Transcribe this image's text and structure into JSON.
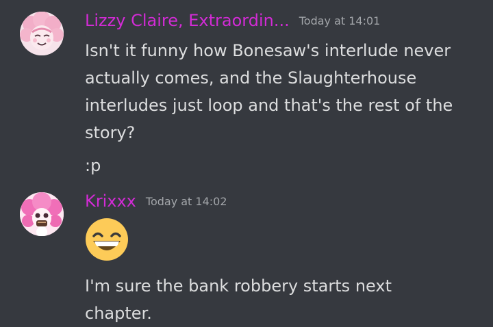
{
  "colors": {
    "background": "#36393f",
    "username": "#d22bd5",
    "text": "#dcddde",
    "timestamp": "#a3a6aa"
  },
  "messages": [
    {
      "author": "Lizzy Claire, Extraordin...",
      "timestamp": "Today at 14:01",
      "avatar_icon": "pink-haired-character-avatar",
      "lines": [
        "Isn't it funny how Bonesaw's interlude never actually comes, and the Slaughterhouse interludes just loop and that's the rest of the story?",
        ":p"
      ]
    },
    {
      "author": "Krixxx",
      "timestamp": "Today at 14:02",
      "avatar_icon": "pink-haired-character-avatar",
      "emoji": "grinning-face-with-smiling-eyes-emoji",
      "lines": [
        "I'm sure the bank robbery starts next chapter."
      ]
    }
  ]
}
